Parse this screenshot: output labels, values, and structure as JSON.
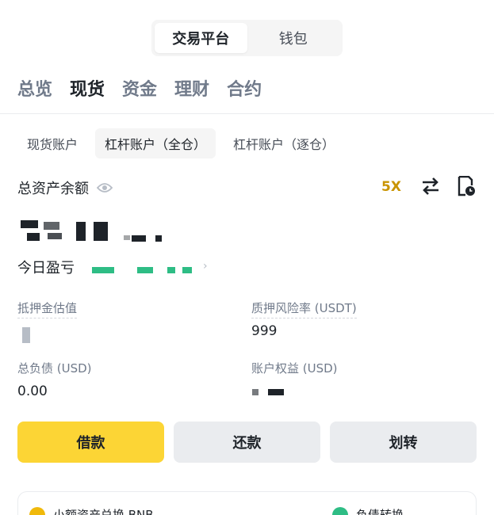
{
  "segment": {
    "items": [
      "交易平台",
      "钱包"
    ],
    "active": 0
  },
  "tabs": [
    "总览",
    "现货",
    "资金",
    "理财",
    "合约"
  ],
  "subtabs": [
    "现货账户",
    "杠杆账户（全仓）",
    "杠杆账户（逐仓）"
  ],
  "balance": {
    "label": "总资产余额",
    "leverage": "5X"
  },
  "pnl": {
    "label": "今日盈亏",
    "chevron": "›"
  },
  "stats": {
    "collateral_label": "抵押金估值",
    "margin_ratio_label": "质押风险率 (USDT)",
    "margin_ratio_value": "999",
    "liabilities_label": "总负债 (USD)",
    "liabilities_value": "0.00",
    "equity_label": "账户权益 (USD)"
  },
  "buttons": {
    "borrow": "借款",
    "repay": "还款",
    "transfer": "划转"
  },
  "card": {
    "convert_label": "小额资产兑换 BNB",
    "debt_label": "负债转换"
  },
  "colors": {
    "accent": "#fcd535",
    "leverage": "#c99400",
    "profit": "#2ebd85"
  }
}
